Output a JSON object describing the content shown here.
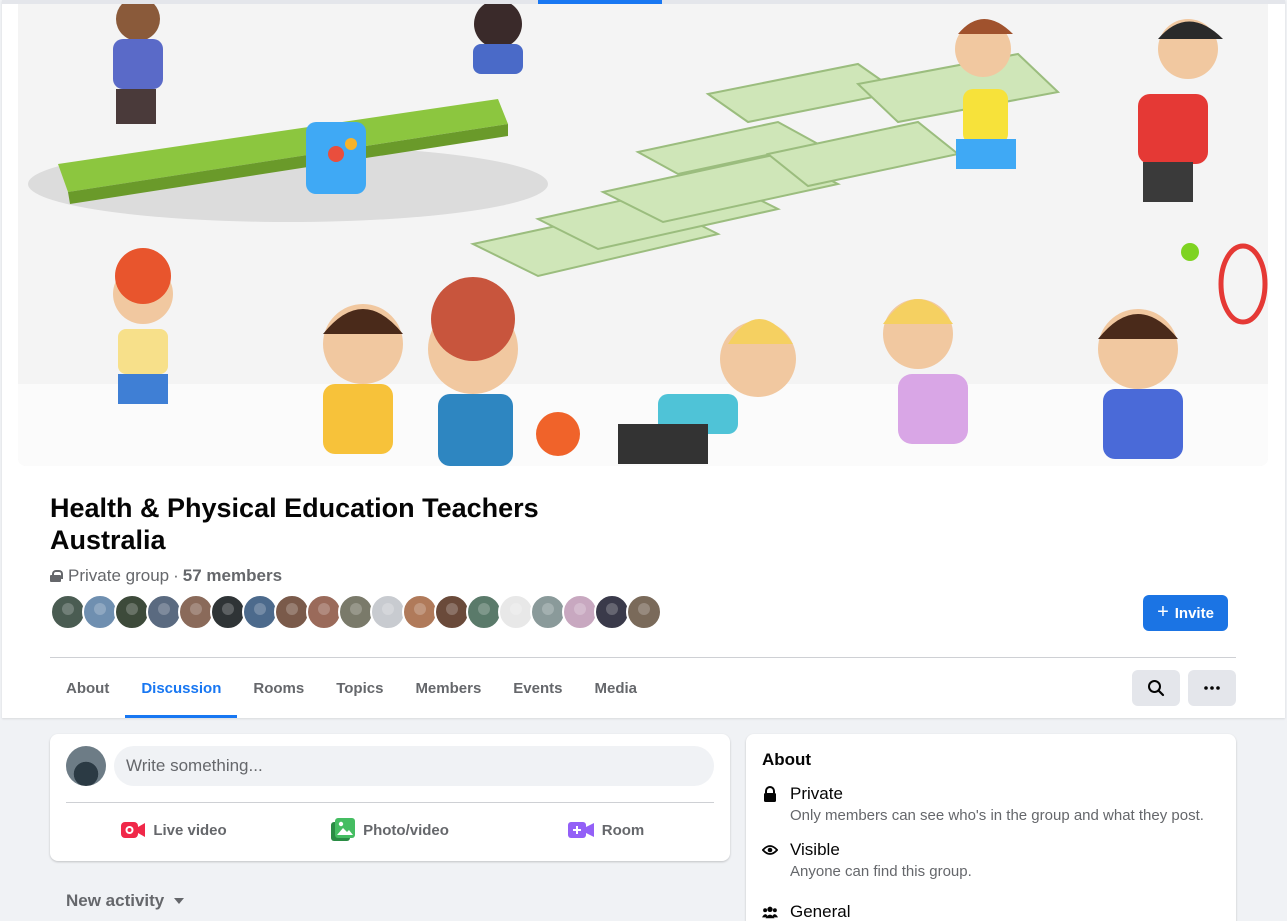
{
  "group": {
    "title": "Health & Physical Education Teachers Australia",
    "privacy": "Private group",
    "separator": "·",
    "members": "57 members",
    "invite_label": "Invite",
    "member_avatar_colors": [
      "#4a5c52",
      "#6f8fb0",
      "#3d4a3a",
      "#5a6a80",
      "#8a6a5a",
      "#2f3436",
      "#4c6a8c",
      "#7a5a4a",
      "#9a6a5a",
      "#7a7a6a",
      "#c8cbd0",
      "#b07a5a",
      "#6a4a3a",
      "#5a7a6a",
      "#e8e8e8",
      "#8a9a9a",
      "#c8a8c0",
      "#3a3a4a",
      "#7a6a5a"
    ]
  },
  "tabs": [
    {
      "label": "About",
      "active": false
    },
    {
      "label": "Discussion",
      "active": true
    },
    {
      "label": "Rooms",
      "active": false
    },
    {
      "label": "Topics",
      "active": false
    },
    {
      "label": "Members",
      "active": false
    },
    {
      "label": "Events",
      "active": false
    },
    {
      "label": "Media",
      "active": false
    }
  ],
  "toolbar": {
    "search_icon": "search-icon",
    "more_icon": "more-horizontal-icon"
  },
  "composer": {
    "placeholder": "Write something...",
    "live_video": "Live video",
    "photo_video": "Photo/video",
    "room": "Room"
  },
  "feed": {
    "sort_label": "New activity"
  },
  "about": {
    "heading": "About",
    "private_title": "Private",
    "private_desc": "Only members can see who's in the group and what they post.",
    "visible_title": "Visible",
    "visible_desc": "Anyone can find this group.",
    "general_title": "General"
  },
  "colors": {
    "accent": "#1877f2",
    "button": "#1b74e4",
    "live_red": "#f02849",
    "photo_green": "#45bd62",
    "room_purple": "#9360f7"
  }
}
